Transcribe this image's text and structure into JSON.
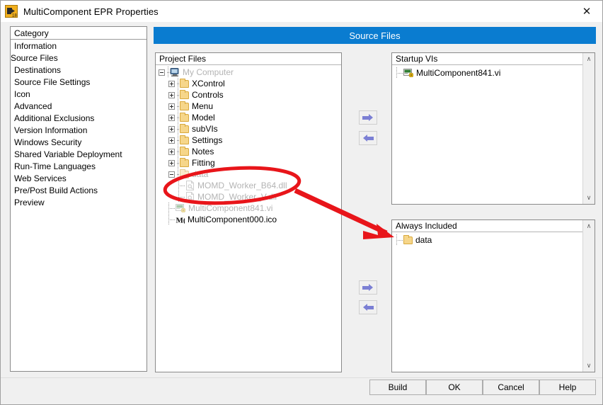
{
  "window": {
    "title": "MultiComponent EPR Properties",
    "app_icon": "labview-build-spec-icon",
    "close_label": "✕"
  },
  "page_header": {
    "title": "Source Files"
  },
  "category": {
    "header": "Category",
    "selected": "Source Files",
    "items": [
      {
        "label": "Information",
        "selected": false
      },
      {
        "label": "Source Files",
        "selected": true
      },
      {
        "label": "Destinations",
        "selected": false
      },
      {
        "label": "Source File Settings",
        "selected": false
      },
      {
        "label": "Icon",
        "selected": false
      },
      {
        "label": "Advanced",
        "selected": false
      },
      {
        "label": "Additional Exclusions",
        "selected": false
      },
      {
        "label": "Version Information",
        "selected": false
      },
      {
        "label": "Windows Security",
        "selected": false
      },
      {
        "label": "Shared Variable Deployment",
        "selected": false
      },
      {
        "label": "Run-Time Languages",
        "selected": false
      },
      {
        "label": "Web Services",
        "selected": false
      },
      {
        "label": "Pre/Post Build Actions",
        "selected": false
      },
      {
        "label": "Preview",
        "selected": false
      }
    ]
  },
  "project_files": {
    "header": "Project Files",
    "tree": [
      {
        "label": "My Computer",
        "icon": "computer-icon",
        "depth": 0,
        "expander": "minus",
        "dim": true
      },
      {
        "label": "XControl",
        "icon": "folder-icon",
        "depth": 1,
        "expander": "plus",
        "dim": false
      },
      {
        "label": "Controls",
        "icon": "folder-icon",
        "depth": 1,
        "expander": "plus",
        "dim": false
      },
      {
        "label": "Menu",
        "icon": "folder-icon",
        "depth": 1,
        "expander": "plus",
        "dim": false
      },
      {
        "label": "Model",
        "icon": "folder-icon",
        "depth": 1,
        "expander": "plus",
        "dim": false
      },
      {
        "label": "subVIs",
        "icon": "folder-icon",
        "depth": 1,
        "expander": "plus",
        "dim": false
      },
      {
        "label": "Settings",
        "icon": "folder-icon",
        "depth": 1,
        "expander": "plus",
        "dim": false
      },
      {
        "label": "Notes",
        "icon": "folder-icon",
        "depth": 1,
        "expander": "plus",
        "dim": false
      },
      {
        "label": "Fitting",
        "icon": "folder-icon",
        "depth": 1,
        "expander": "plus",
        "dim": false
      },
      {
        "label": "data",
        "icon": "folder-icon",
        "depth": 1,
        "expander": "minus",
        "dim": true
      },
      {
        "label": "MOMD_Worker_B64.dll",
        "icon": "dll-icon",
        "depth": 2,
        "expander": "none",
        "dim": true
      },
      {
        "label": "MOMD_Worker_V.dll",
        "icon": "dll-icon",
        "depth": 2,
        "expander": "none",
        "dim": true
      },
      {
        "label": "MultiComponent841.vi",
        "icon": "vi-icon",
        "depth": 1,
        "expander": "none",
        "dim": true
      },
      {
        "label": "MultiComponent000.ico",
        "icon": "ico-icon",
        "depth": 1,
        "expander": "none",
        "dim": false
      }
    ]
  },
  "startup_vis": {
    "header": "Startup VIs",
    "items": [
      {
        "label": "MultiComponent841.vi",
        "icon": "vi-icon"
      }
    ],
    "scrollbar": {
      "up": "∧",
      "down": "∨"
    }
  },
  "always_included": {
    "header": "Always Included",
    "items": [
      {
        "label": "data",
        "icon": "folder-icon"
      }
    ],
    "scrollbar": {
      "up": "∧",
      "down": "∨"
    }
  },
  "transfer_buttons": [
    {
      "name": "add-startup-vi",
      "direction": "right",
      "icon": "arrow-right-icon"
    },
    {
      "name": "remove-startup-vi",
      "direction": "left",
      "icon": "arrow-left-icon"
    },
    {
      "name": "add-always-included",
      "direction": "right",
      "icon": "arrow-right-icon"
    },
    {
      "name": "remove-always-included",
      "direction": "left",
      "icon": "arrow-left-icon"
    }
  ],
  "footer_buttons": [
    {
      "label": "Build"
    },
    {
      "label": "OK"
    },
    {
      "label": "Cancel"
    },
    {
      "label": "Help"
    }
  ],
  "annotations": {
    "ellipse_label": "red-ellipse-highlight",
    "arrow_label": "red-arrow-pointing-to-always-included",
    "color": "#e8151a"
  },
  "colors": {
    "accent_blue": "#0a7cd0",
    "selection_blue": "#0a7fd4",
    "annotation_red": "#e8151a",
    "arrow_purple": "#7b7fd4",
    "folder_yellow": "#f6d68a",
    "window_bg": "#f0f0f0"
  }
}
